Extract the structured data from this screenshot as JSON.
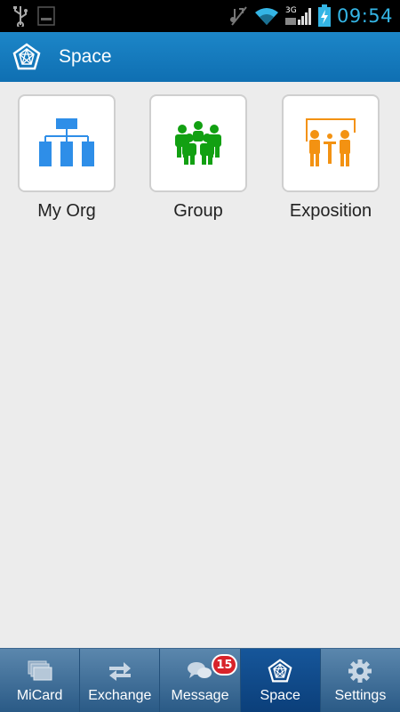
{
  "status_bar": {
    "time": "09:54",
    "network_label": "3G",
    "icons": [
      "usb-icon",
      "notification-icon",
      "mute-icon",
      "wifi-icon",
      "signal-icon",
      "battery-charging-icon"
    ]
  },
  "app_bar": {
    "title": "Space",
    "icon": "pentagon-star-icon"
  },
  "tiles": [
    {
      "label": "My Org",
      "icon": "org-chart-icon",
      "color": "#2e8ee8"
    },
    {
      "label": "Group",
      "icon": "group-people-icon",
      "color": "#12a012"
    },
    {
      "label": "Exposition",
      "icon": "exposition-icon",
      "color": "#f39212"
    }
  ],
  "tabs": [
    {
      "label": "MiCard",
      "icon": "cards-icon",
      "active": false
    },
    {
      "label": "Exchange",
      "icon": "exchange-arrows-icon",
      "active": false
    },
    {
      "label": "Message",
      "icon": "chat-bubbles-icon",
      "active": false,
      "badge": "15"
    },
    {
      "label": "Space",
      "icon": "pentagon-star-icon",
      "active": true
    },
    {
      "label": "Settings",
      "icon": "gear-icon",
      "active": false
    }
  ],
  "colors": {
    "app_bar": "#1479bf",
    "tab_bar": "#3d6d98",
    "tab_active": "#0f4a88",
    "badge": "#d8232a",
    "background": "#ececec"
  }
}
